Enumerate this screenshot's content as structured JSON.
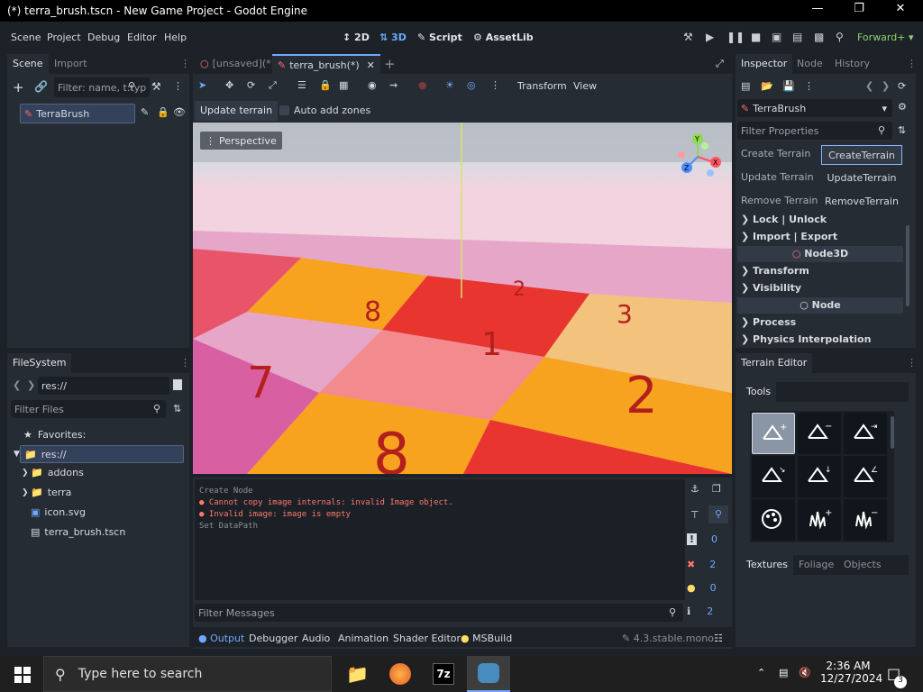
{
  "window": {
    "title": "(*) terra_brush.tscn - New Game Project - Godot Engine"
  },
  "menu": [
    "Scene",
    "Project",
    "Debug",
    "Editor",
    "Help"
  ],
  "workspaces": {
    "d2": "2D",
    "d3": "3D",
    "script": "Script",
    "assetlib": "AssetLib"
  },
  "renderer": "Forward+",
  "scene_dock": {
    "tabs": [
      "Scene",
      "Import"
    ],
    "filter_placeholder": "Filter: name, t:typ",
    "root_node": "TerraBrush"
  },
  "filesystem_dock": {
    "tab": "FileSystem",
    "path": "res://",
    "filter_placeholder": "Filter Files",
    "favorites_label": "Favorites:",
    "items": [
      "res://",
      "addons",
      "terra",
      "icon.svg",
      "terra_brush.tscn"
    ]
  },
  "editor_tabs": [
    "[unsaved](*)",
    "terra_brush(*)"
  ],
  "toolbar3d": {
    "transform": "Transform",
    "view": "View"
  },
  "terrain_bar": {
    "update_terrain": "Update terrain",
    "auto_add_zones": "Auto add zones"
  },
  "viewport": {
    "perspective_label": "Perspective",
    "gizmo_axes": {
      "x": "X",
      "y": "Y",
      "z": "Z"
    }
  },
  "output": {
    "lines": [
      {
        "text": "Create Node",
        "type": "info"
      },
      {
        "text": "Cannot copy image internals: invalid Image object.",
        "type": "error"
      },
      {
        "text": "Invalid image: image is empty",
        "type": "error"
      },
      {
        "text": "Set DataPath",
        "type": "info"
      }
    ],
    "filter_placeholder": "Filter Messages",
    "counts": {
      "messages": "0",
      "errors": "2",
      "warnings": "0",
      "info": "2"
    },
    "bottom_tabs": [
      "Output",
      "Debugger",
      "Audio",
      "Animation",
      "Shader Editor",
      "MSBuild"
    ],
    "version": "4.3.stable.mono"
  },
  "inspector": {
    "tabs": [
      "Inspector",
      "Node",
      "History"
    ],
    "node_name": "TerraBrush",
    "filter_placeholder": "Filter Properties",
    "buttons": [
      {
        "label": "Create Terrain",
        "value": "CreateTerrain"
      },
      {
        "label": "Update Terrain",
        "value": "UpdateTerrain"
      },
      {
        "label": "Remove Terrain",
        "value": "RemoveTerrain"
      }
    ],
    "groups1": [
      "Lock | Unlock",
      "Import | Export"
    ],
    "cat1": "Node3D",
    "groups2": [
      "Transform",
      "Visibility"
    ],
    "cat2": "Node",
    "groups3": [
      "Process",
      "Physics Interpolation"
    ]
  },
  "terrain_editor": {
    "title": "Terrain Editor",
    "tools_tab": "Tools",
    "bottom_tabs": [
      "Textures",
      "Foliage",
      "Objects"
    ]
  },
  "taskbar": {
    "search_placeholder": "Type here to search",
    "time": "2:36 AM",
    "date": "12/27/2024",
    "notification_count": "3"
  },
  "colors": {
    "accent": "#6fa8ff",
    "error": "#ff786b",
    "warning": "#ffdd65"
  }
}
